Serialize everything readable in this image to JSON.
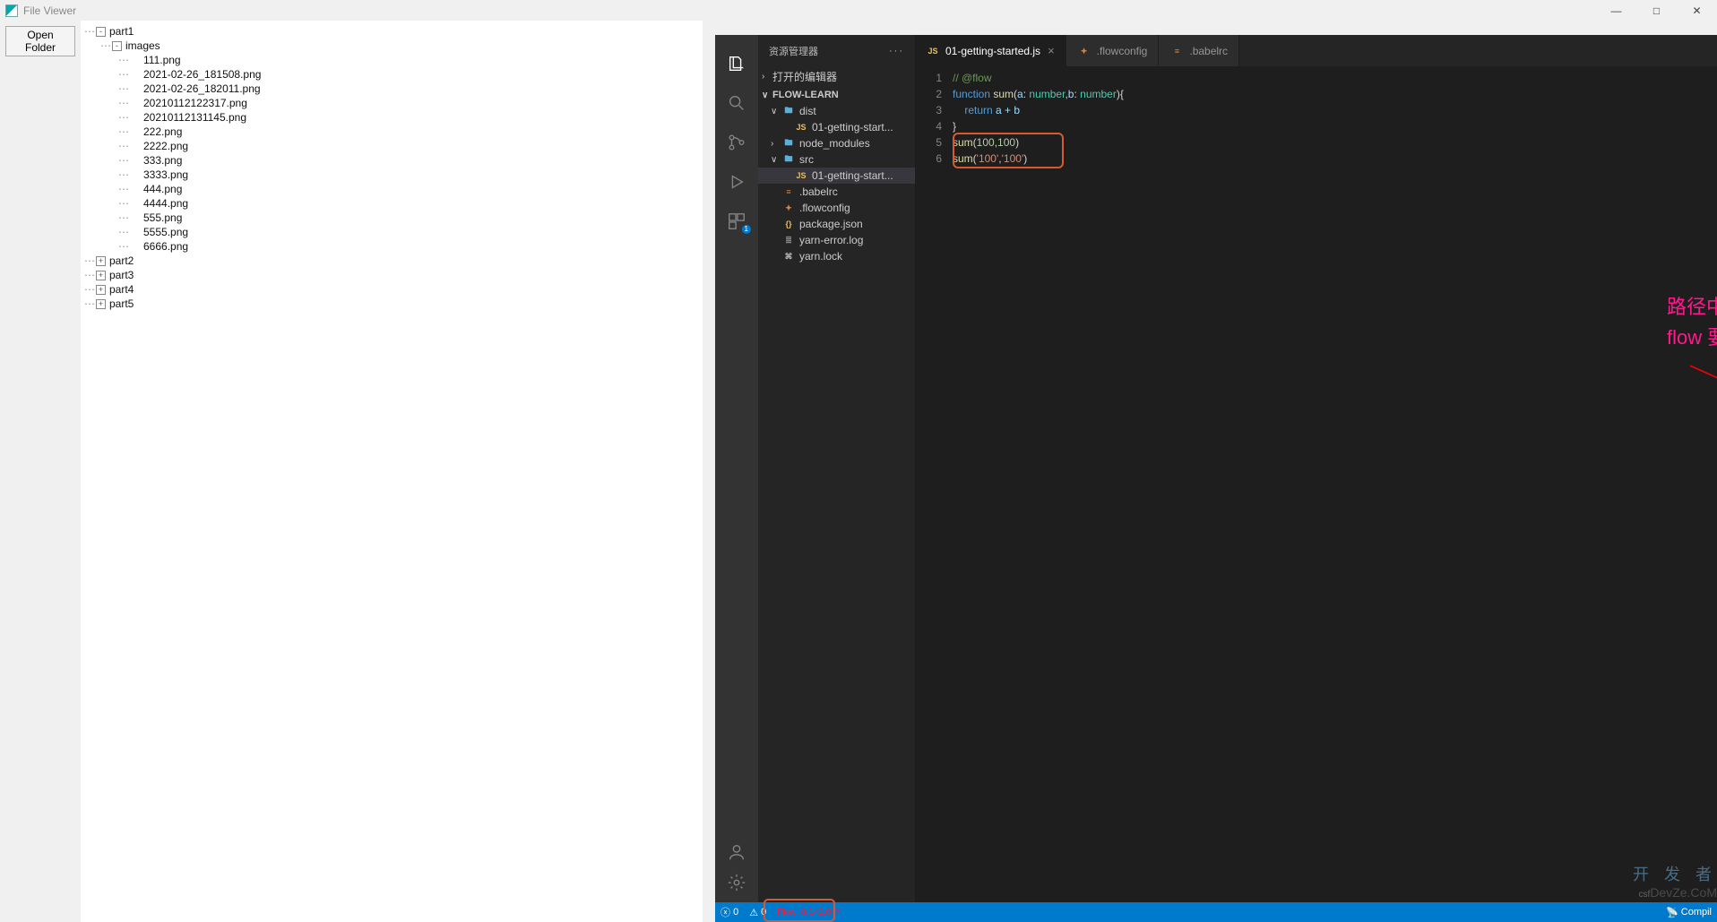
{
  "fileViewer": {
    "title": "File Viewer",
    "openFolderLabel": "Open Folder",
    "tree": [
      {
        "depth": 0,
        "toggle": "-",
        "label": "part1"
      },
      {
        "depth": 1,
        "toggle": "-",
        "label": "images"
      },
      {
        "depth": 2,
        "toggle": "",
        "label": "111.png"
      },
      {
        "depth": 2,
        "toggle": "",
        "label": "2021-02-26_181508.png"
      },
      {
        "depth": 2,
        "toggle": "",
        "label": "2021-02-26_182011.png"
      },
      {
        "depth": 2,
        "toggle": "",
        "label": "20210112122317.png"
      },
      {
        "depth": 2,
        "toggle": "",
        "label": "20210112131145.png"
      },
      {
        "depth": 2,
        "toggle": "",
        "label": "222.png"
      },
      {
        "depth": 2,
        "toggle": "",
        "label": "2222.png"
      },
      {
        "depth": 2,
        "toggle": "",
        "label": "333.png"
      },
      {
        "depth": 2,
        "toggle": "",
        "label": "3333.png"
      },
      {
        "depth": 2,
        "toggle": "",
        "label": "444.png"
      },
      {
        "depth": 2,
        "toggle": "",
        "label": "4444.png"
      },
      {
        "depth": 2,
        "toggle": "",
        "label": "555.png"
      },
      {
        "depth": 2,
        "toggle": "",
        "label": "5555.png"
      },
      {
        "depth": 2,
        "toggle": "",
        "label": "6666.png"
      },
      {
        "depth": 0,
        "toggle": "+",
        "label": "part2"
      },
      {
        "depth": 0,
        "toggle": "+",
        "label": "part3"
      },
      {
        "depth": 0,
        "toggle": "+",
        "label": "part4"
      },
      {
        "depth": 0,
        "toggle": "+",
        "label": "part5"
      }
    ]
  },
  "vscode": {
    "sidebar": {
      "title": "资源管理器",
      "openEditorsLabel": "打开的编辑器",
      "projectName": "FLOW-LEARN",
      "tree": [
        {
          "indent": 14,
          "chev": "∨",
          "icon": "folder",
          "iconText": "🖿",
          "label": "dist",
          "active": false
        },
        {
          "indent": 28,
          "chev": "",
          "icon": "js",
          "iconText": "JS",
          "label": "01-getting-start...",
          "active": false
        },
        {
          "indent": 14,
          "chev": "›",
          "icon": "folder",
          "iconText": "🖿",
          "label": "node_modules",
          "active": false
        },
        {
          "indent": 14,
          "chev": "∨",
          "icon": "folder",
          "iconText": "🖿",
          "label": "src",
          "active": false
        },
        {
          "indent": 28,
          "chev": "",
          "icon": "js",
          "iconText": "JS",
          "label": "01-getting-start...",
          "active": true
        },
        {
          "indent": 14,
          "chev": "",
          "icon": "config",
          "iconText": "≡",
          "label": ".babelrc",
          "active": false
        },
        {
          "indent": 14,
          "chev": "",
          "icon": "config",
          "iconText": "🟆",
          "label": ".flowconfig",
          "active": false
        },
        {
          "indent": 14,
          "chev": "",
          "icon": "json",
          "iconText": "{}",
          "label": "package.json",
          "active": false
        },
        {
          "indent": 14,
          "chev": "",
          "icon": "log",
          "iconText": "≣",
          "label": "yarn-error.log",
          "active": false
        },
        {
          "indent": 14,
          "chev": "",
          "icon": "lock",
          "iconText": "⌘",
          "label": "yarn.lock",
          "active": false
        }
      ]
    },
    "activityBadge": "1",
    "tabs": [
      {
        "icon": "js",
        "iconText": "JS",
        "label": "01-getting-started.js",
        "active": true,
        "closable": true
      },
      {
        "icon": "config",
        "iconText": "🟆",
        "label": ".flowconfig",
        "active": false,
        "closable": false
      },
      {
        "icon": "config",
        "iconText": "≡",
        "label": ".babelrc",
        "active": false,
        "closable": false
      }
    ],
    "code": {
      "lineNumbers": [
        "1",
        "2",
        "3",
        "4",
        "5",
        "6"
      ],
      "lines": {
        "l1_comment": "// @flow",
        "l2_kw": "function",
        "l2_fn": "sum",
        "l2_p1": "a",
        "l2_t": "number",
        "l2_p2": "b",
        "l3_kw": "return",
        "l3_expr": "a + b",
        "l5_fn": "sum",
        "l5_a": "100",
        "l5_b": "100",
        "l6_fn": "sum",
        "l6_a": "'100'",
        "l6_b": "'100'"
      }
    },
    "annotation": {
      "line1": "路径中出现这样的数字, 很有可",
      "line2": "flow 要求整个路径目录,文件都"
    },
    "status": {
      "errors": "0",
      "warnings": "0",
      "flow": "Flow: 0.142.0",
      "compile": "Compil"
    },
    "watermark": {
      "cn": "开 发 者",
      "en": "DevZe.CoM",
      "csf": "csf"
    }
  }
}
